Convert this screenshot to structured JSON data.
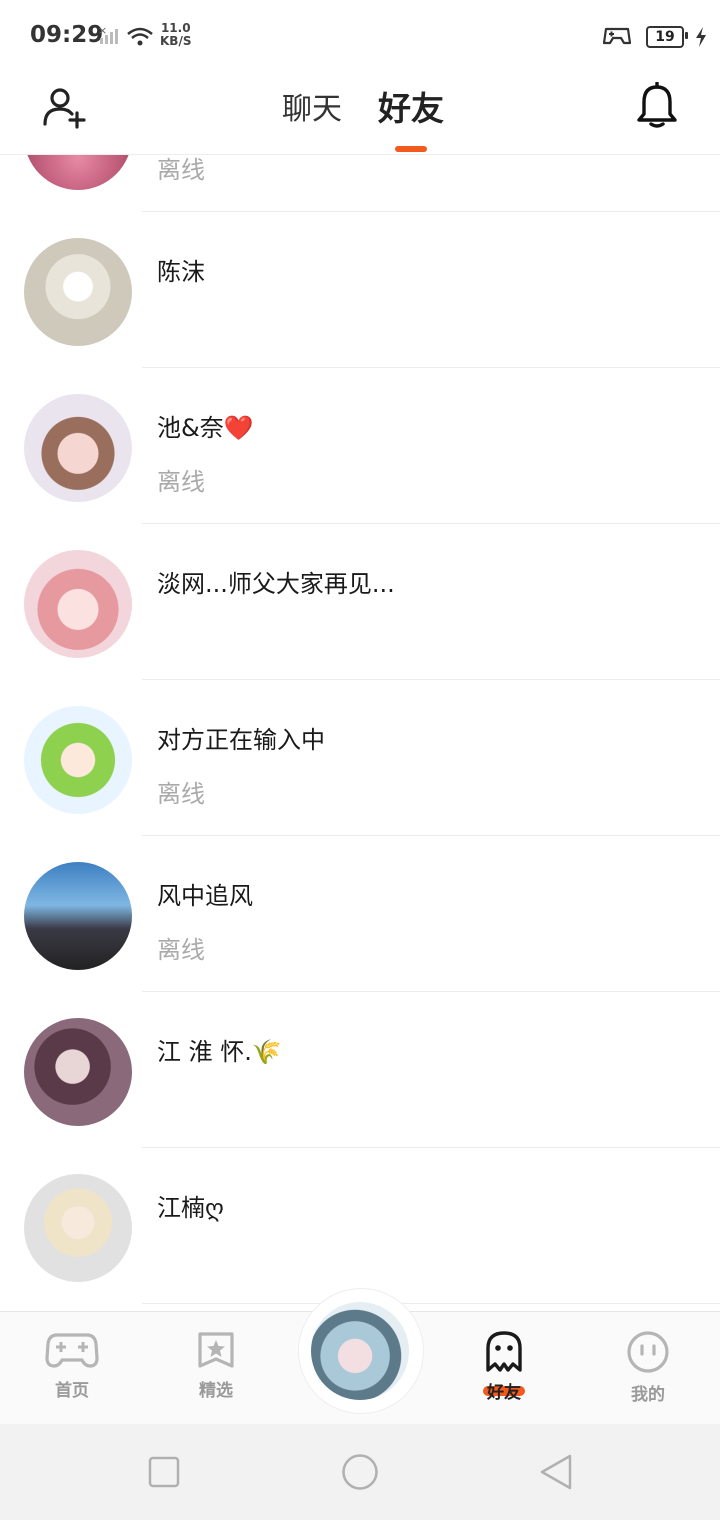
{
  "status_bar": {
    "time": "09:29",
    "net_speed_value": "11.0",
    "net_speed_unit": "KB/S",
    "battery": "19"
  },
  "header": {
    "tabs": [
      {
        "label": "聊天",
        "active": false
      },
      {
        "label": "好友",
        "active": true
      }
    ],
    "add_friend_icon": "add-user-icon",
    "notification_icon": "bell-icon",
    "accent_color": "#f25a1e"
  },
  "friends": [
    {
      "name": "",
      "status": "离线"
    },
    {
      "name": "陈沫",
      "status": ""
    },
    {
      "name": "池&奈❤️",
      "status": "离线"
    },
    {
      "name": "淡网...师父大家再见...",
      "status": ""
    },
    {
      "name": "对方正在输入中",
      "status": "离线"
    },
    {
      "name": "风中追风",
      "status": "离线"
    },
    {
      "name": "江 淮 怀.🌾",
      "status": ""
    },
    {
      "name": "江楠ღ",
      "status": ""
    }
  ],
  "tabbar": {
    "items": [
      {
        "label": "首页",
        "icon": "gamepad-icon"
      },
      {
        "label": "精选",
        "icon": "star-bookmark-icon"
      },
      {
        "label": "好友",
        "icon": "ghost-icon",
        "active": true
      },
      {
        "label": "我的",
        "icon": "smiley-face-icon"
      }
    ]
  }
}
